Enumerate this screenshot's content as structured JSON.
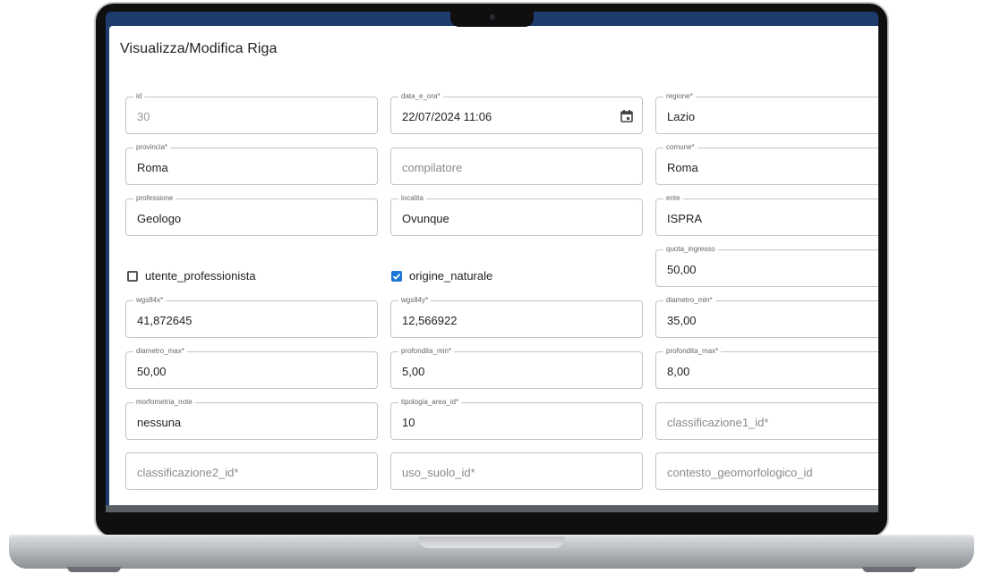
{
  "dialog": {
    "title": "Visualizza/Modifica Riga"
  },
  "fields": {
    "id": {
      "label": "id",
      "value": "30"
    },
    "data_e_ora": {
      "label": "data_e_ora*",
      "value": "22/07/2024 11:06"
    },
    "regione": {
      "label": "regione*",
      "value": "Lazio"
    },
    "provincia": {
      "label": "provincia*",
      "value": "Roma"
    },
    "compilatore": {
      "placeholder": "compilatore"
    },
    "comune": {
      "label": "comune*",
      "value": "Roma"
    },
    "professione": {
      "label": "professione",
      "value": "Geologo"
    },
    "localita": {
      "label": "localita",
      "value": "Ovunque"
    },
    "ente": {
      "label": "ente",
      "value": "ISPRA"
    },
    "quota_ingresso": {
      "label": "quota_ingresso",
      "value": "50,00"
    },
    "wgs84x": {
      "label": "wgs84x*",
      "value": "41,872645"
    },
    "wgs84y": {
      "label": "wgs84y*",
      "value": "12,566922"
    },
    "diametro_min": {
      "label": "diametro_min*",
      "value": "35,00"
    },
    "diametro_max": {
      "label": "diametro_max*",
      "value": "50,00"
    },
    "profondita_min": {
      "label": "profondita_min*",
      "value": "5,00"
    },
    "profondita_max": {
      "label": "profondita_max*",
      "value": "8,00"
    },
    "morfometria_note": {
      "label": "morfometria_note",
      "value": "nessuna"
    },
    "tipologia_area_id": {
      "label": "tipologia_area_id*",
      "value": "10"
    },
    "classificazione1_id": {
      "placeholder": "classificazione1_id*"
    },
    "classificazione2_id": {
      "placeholder": "classificazione2_id*"
    },
    "uso_suolo_id": {
      "placeholder": "uso_suolo_id*"
    },
    "contesto_geomorfologico_id": {
      "placeholder": "contesto_geomorfologico_id"
    }
  },
  "checkboxes": {
    "utente_professionista": {
      "label": "utente_professionista",
      "checked": false
    },
    "origine_naturale": {
      "label": "origine_naturale",
      "checked": true
    }
  },
  "colors": {
    "accent": "#1976d2",
    "header": "#1d3c6b"
  }
}
